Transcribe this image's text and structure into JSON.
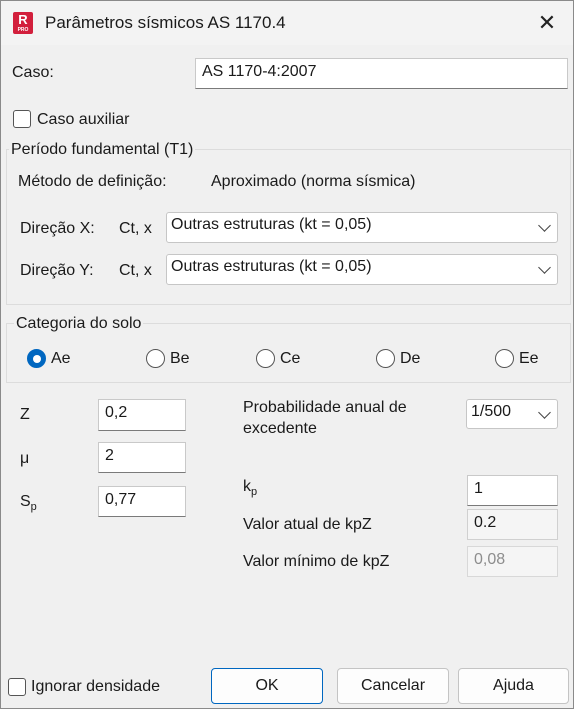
{
  "window": {
    "title": "Parâmetros sísmicos AS 1170.4",
    "icon_letter": "R",
    "icon_sub": "PRO"
  },
  "caso": {
    "label": "Caso:",
    "value": "AS 1170-4:2007"
  },
  "caso_auxiliar": {
    "label": "Caso auxiliar",
    "checked": false
  },
  "periodo": {
    "title": "Período fundamental (T1)",
    "metodo_label": "Método de definição:",
    "metodo_value": "Aproximado (norma sísmica)",
    "dir_x_label": "Direção X:",
    "dir_x_ct": "Ct, x",
    "dir_x_value": "Outras estruturas (kt = 0,05)",
    "dir_y_label": "Direção Y:",
    "dir_y_ct": "Ct, x",
    "dir_y_value": "Outras estruturas (kt = 0,05)"
  },
  "solo": {
    "title": "Categoria do solo",
    "options": [
      "Ae",
      "Be",
      "Ce",
      "De",
      "Ee"
    ],
    "selected": "Ae"
  },
  "params": {
    "z_label": "Z",
    "z_value": "0,2",
    "mu_label": "μ",
    "mu_value": "2",
    "sp_label_main": "S",
    "sp_label_sub": "p",
    "sp_value": "0,77"
  },
  "prob": {
    "label_line1": "Probabilidade anual de",
    "label_line2": "excedente",
    "value": "1/500"
  },
  "kp": {
    "label_main": "k",
    "label_sub": "p",
    "value": "1"
  },
  "kpz_atual": {
    "label": "Valor atual de kpZ",
    "value": "0.2"
  },
  "kpz_min": {
    "label": "Valor mínimo de kpZ",
    "value": "0,08"
  },
  "ignorar": {
    "label": "Ignorar densidade",
    "checked": false
  },
  "buttons": {
    "ok": "OK",
    "cancel": "Cancelar",
    "help": "Ajuda"
  },
  "colors": {
    "accent": "#0067c0",
    "brand": "#d21f3c"
  },
  "icons": {
    "close": "close-icon",
    "dropdown": "chevron-down-icon"
  }
}
